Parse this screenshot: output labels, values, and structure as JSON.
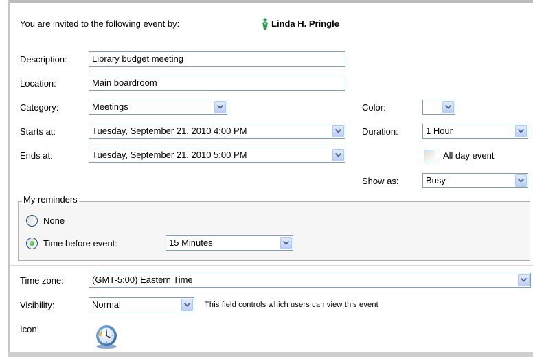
{
  "invite": {
    "prefix": "You are invited to the following event by:",
    "organizer": "Linda H. Pringle"
  },
  "labels": {
    "description": "Description:",
    "location": "Location:",
    "category": "Category:",
    "starts_at": "Starts at:",
    "ends_at": "Ends at:",
    "color": "Color:",
    "duration": "Duration:",
    "all_day": "All day event",
    "show_as": "Show as:",
    "time_zone": "Time zone:",
    "visibility": "Visibility:",
    "icon": "Icon:"
  },
  "fields": {
    "description": "Library budget meeting",
    "location": "Main boardroom",
    "category": "Meetings",
    "color": "",
    "starts_at": "Tuesday, September 21, 2010 4:00 PM",
    "ends_at": "Tuesday, September 21, 2010 5:00 PM",
    "duration": "1 Hour",
    "all_day_checked": false,
    "show_as": "Busy",
    "time_zone": "(GMT-5:00) Eastern Time",
    "visibility": "Normal",
    "visibility_help": "This field controls which users can view this event",
    "icon": "clock-icon"
  },
  "reminders": {
    "legend": "My reminders",
    "none_label": "None",
    "before_label": "Time before event:",
    "selected": "before",
    "before_value": "15 Minutes"
  },
  "colors": {
    "field_border": "#7f9db9",
    "dropdown_button": "#b9cdf6",
    "arrow": "#4d6185",
    "radio_selected": "#21a121",
    "person_icon": "#2e9a4e"
  }
}
